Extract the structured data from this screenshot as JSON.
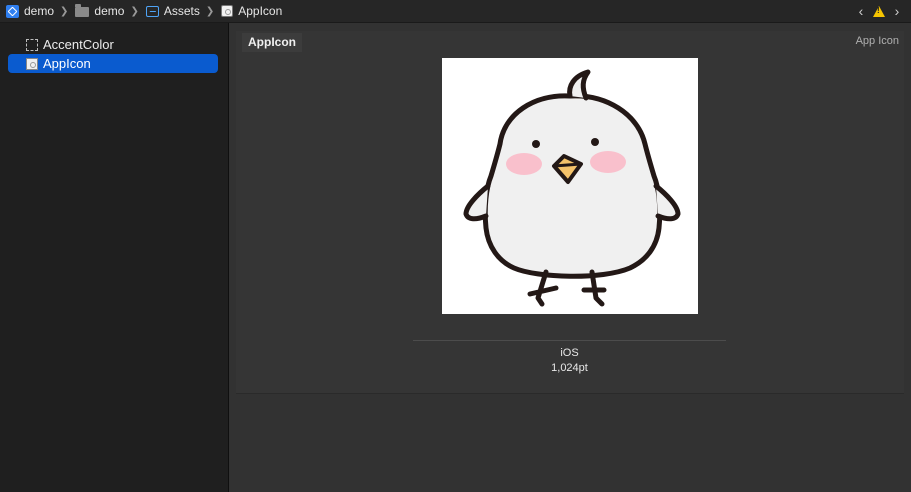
{
  "breadcrumb": {
    "items": [
      {
        "label": "demo",
        "icon": "xcode-project-icon"
      },
      {
        "label": "demo",
        "icon": "folder-icon"
      },
      {
        "label": "Assets",
        "icon": "asset-catalog-icon"
      },
      {
        "label": "AppIcon",
        "icon": "app-icon-set-icon"
      }
    ],
    "separator": "❯"
  },
  "navigation": {
    "back_icon": "chevron-left-icon",
    "warning_icon": "warning-triangle-icon",
    "forward_icon": "chevron-right-icon"
  },
  "sidebar": {
    "items": [
      {
        "label": "AccentColor",
        "icon": "color-set-icon",
        "selected": false
      },
      {
        "label": "AppIcon",
        "icon": "app-icon-set-icon",
        "selected": true
      }
    ]
  },
  "editor": {
    "title": "AppIcon",
    "type_label": "App Icon",
    "slot": {
      "platform": "iOS",
      "size": "1,024pt",
      "image": "cartoon-bird-icon"
    }
  },
  "colors": {
    "selection": "#0a5bcf",
    "warning": "#f5c400",
    "sidebar_bg": "#1f1f1f",
    "editor_bg": "#323232"
  }
}
